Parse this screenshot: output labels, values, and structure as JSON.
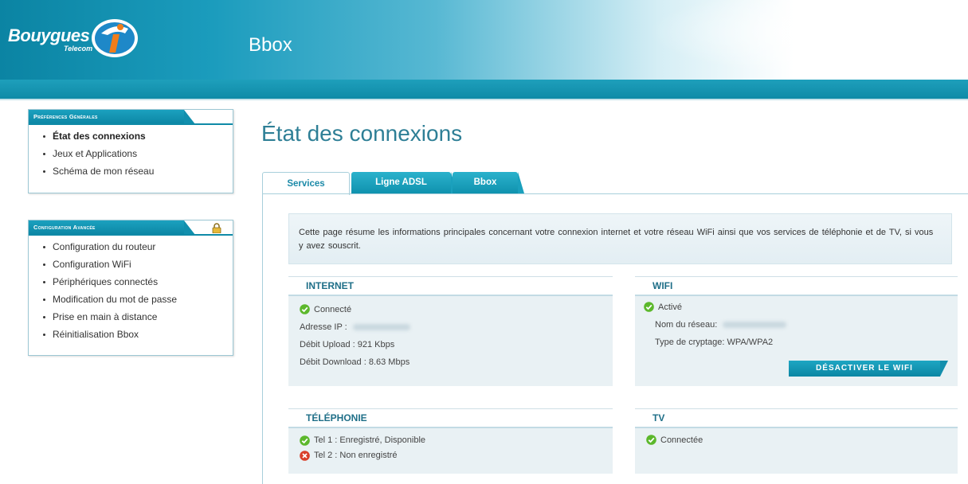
{
  "header": {
    "brand_main": "Bouygues",
    "brand_sub": "Telecom",
    "app_title": "Bbox"
  },
  "sidebar": {
    "general": {
      "heading": "Préférences Générales",
      "items": [
        {
          "label": "État des connexions",
          "active": true
        },
        {
          "label": "Jeux et Applications",
          "active": false
        },
        {
          "label": "Schéma de mon réseau",
          "active": false
        }
      ]
    },
    "advanced": {
      "heading": "Configuration Avancée",
      "items": [
        {
          "label": "Configuration du routeur"
        },
        {
          "label": "Configuration WiFi"
        },
        {
          "label": "Périphériques connectés"
        },
        {
          "label": "Modification du mot de passe"
        },
        {
          "label": "Prise en main à distance"
        },
        {
          "label": "Réinitialisation Bbox"
        }
      ]
    }
  },
  "main": {
    "title": "État des connexions",
    "tabs": [
      {
        "label": "Services",
        "active": true
      },
      {
        "label": "Ligne ADSL",
        "active": false
      },
      {
        "label": "Bbox",
        "active": false
      }
    ],
    "intro": "Cette page résume les informations principales concernant votre connexion internet et votre réseau WiFi ainsi que vos services de téléphonie et de TV, si vous y avez souscrit.",
    "internet": {
      "title": "INTERNET",
      "status": "Connecté",
      "ip_label": "Adresse IP :",
      "upload": "Débit Upload : 921 Kbps",
      "download": "Débit Download : 8.63 Mbps"
    },
    "wifi": {
      "title": "WIFI",
      "status": "Activé",
      "network_label": "Nom du réseau:",
      "crypto": "Type de cryptage: WPA/WPA2",
      "button": "DÉSACTIVER LE WIFI"
    },
    "telephonie": {
      "title": "TÉLÉPHONIE",
      "tel1": "Tel 1 : Enregistré, Disponible",
      "tel2": "Tel 2 : Non enregistré"
    },
    "tv": {
      "title": "TV",
      "status": "Connectée"
    }
  },
  "colors": {
    "brand_teal": "#0f8aa7",
    "title_blue": "#2e7f96",
    "ok_green": "#5cb82c",
    "error_red": "#d9402b"
  }
}
